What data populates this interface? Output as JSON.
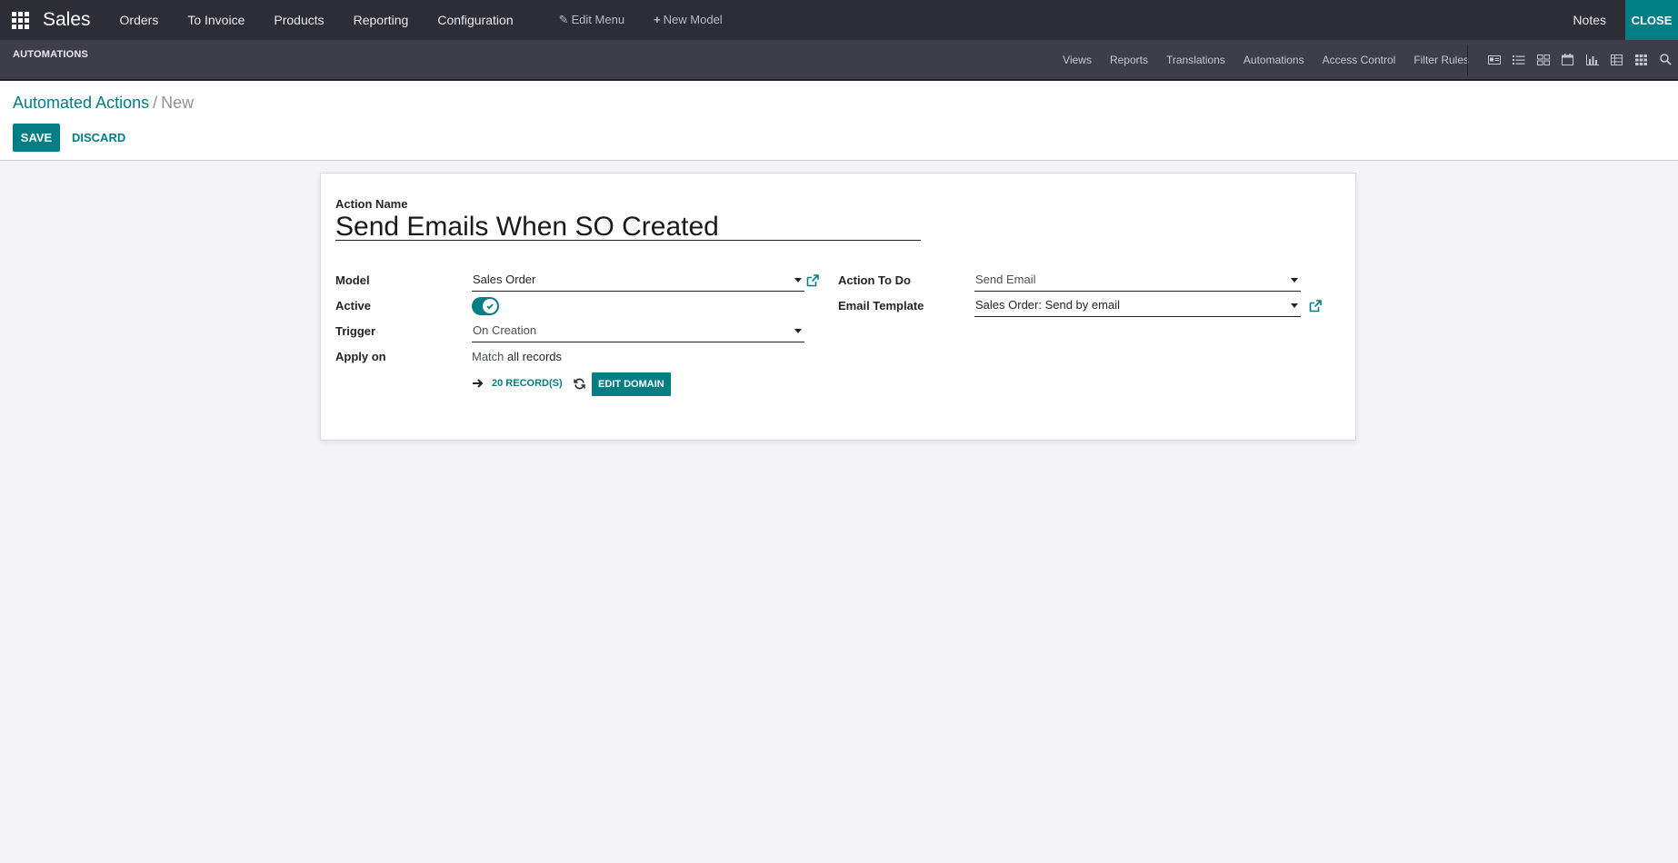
{
  "navbar": {
    "app_name": "Sales",
    "menu": [
      "Orders",
      "To Invoice",
      "Products",
      "Reporting",
      "Configuration"
    ],
    "edit_menu": "Edit Menu",
    "new_model": "New Model",
    "notes": "Notes",
    "close": "CLOSE"
  },
  "subbar": {
    "title": "AUTOMATIONS",
    "links": [
      "Views",
      "Reports",
      "Translations",
      "Automations",
      "Access Control",
      "Filter Rules"
    ],
    "view_icons": [
      "form-view-icon",
      "list-view-icon",
      "kanban-view-icon",
      "calendar-view-icon",
      "graph-view-icon",
      "pivot-view-icon",
      "grid-view-icon",
      "search-icon"
    ]
  },
  "control_panel": {
    "breadcrumb_parent": "Automated Actions",
    "breadcrumb_separator": "/",
    "breadcrumb_current": "New",
    "save": "SAVE",
    "discard": "DISCARD"
  },
  "form": {
    "action_name_label": "Action Name",
    "action_name_value": "Send Emails When SO Created",
    "model_label": "Model",
    "model_value": "Sales Order",
    "active_label": "Active",
    "active_value": true,
    "trigger_label": "Trigger",
    "trigger_value": "On Creation",
    "apply_on_label": "Apply on",
    "apply_on_prefix": "Match",
    "apply_on_value": "all records",
    "records_count": "20 RECORD(S)",
    "edit_domain": "EDIT DOMAIN",
    "action_to_do_label": "Action To Do",
    "action_to_do_value": "Send Email",
    "email_template_label": "Email Template",
    "email_template_value": "Sales Order: Send by email"
  },
  "colors": {
    "primary": "#017e84",
    "navbar": "#2b2e37",
    "subbar": "#3c3f49",
    "background": "#f4f4f8"
  }
}
